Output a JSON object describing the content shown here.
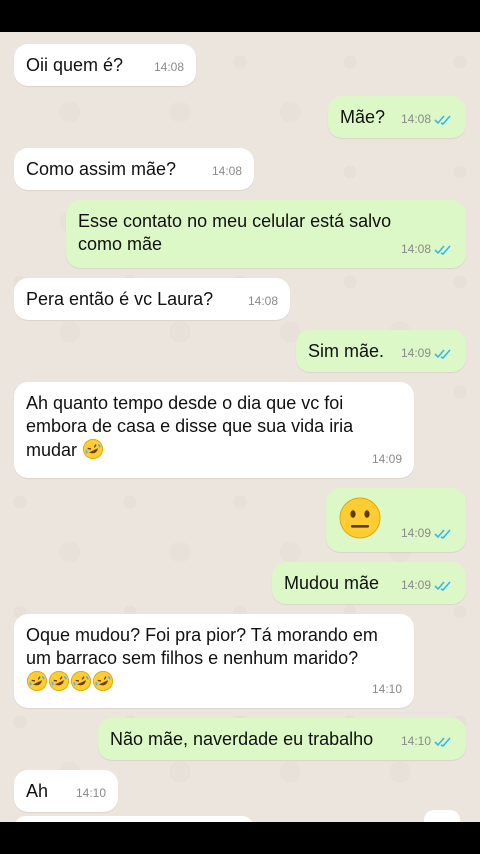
{
  "messages": [
    {
      "side": "in",
      "text": "Oii quem é?",
      "time": "14:08"
    },
    {
      "side": "out",
      "text": "Mãe?",
      "time": "14:08"
    },
    {
      "side": "in",
      "text": "Como assim mãe?",
      "time": "14:08"
    },
    {
      "side": "out",
      "line1": "Esse contato no meu celular está salvo",
      "line2": "como mãe",
      "time": "14:08"
    },
    {
      "side": "in",
      "text": "Pera então é vc Laura?",
      "time": "14:08"
    },
    {
      "side": "out",
      "text": "Sim mãe.",
      "time": "14:09"
    },
    {
      "side": "in",
      "line1": "Ah quanto tempo desde o dia que vc foi",
      "line2": "embora de casa e disse que sua vida iria",
      "line3": "mudar",
      "emoji": "rofl-emoji",
      "time": "14:09"
    },
    {
      "side": "out",
      "emoji": "neutral-face-emoji",
      "time": "14:09"
    },
    {
      "side": "out",
      "text": "Mudou mãe",
      "time": "14:09"
    },
    {
      "side": "in",
      "line1": "Oque mudou? Foi pra pior? Tá morando em",
      "line2": "um barraco sem filhos e nenhum marido?",
      "emoji": "rofl-emoji",
      "emoji_count": 4,
      "time": "14:10"
    },
    {
      "side": "out",
      "text": "Não mãe, naverdade eu trabalho",
      "time": "14:10"
    },
    {
      "side": "in",
      "text": "Ah",
      "time": "14:10"
    }
  ],
  "colors": {
    "incoming_bubble": "#FFFFFF",
    "outgoing_bubble": "#DCF8C6",
    "chat_background": "#ECE5DD",
    "read_ticks": "#34B7F1",
    "timestamp": "#8a8a8a"
  }
}
